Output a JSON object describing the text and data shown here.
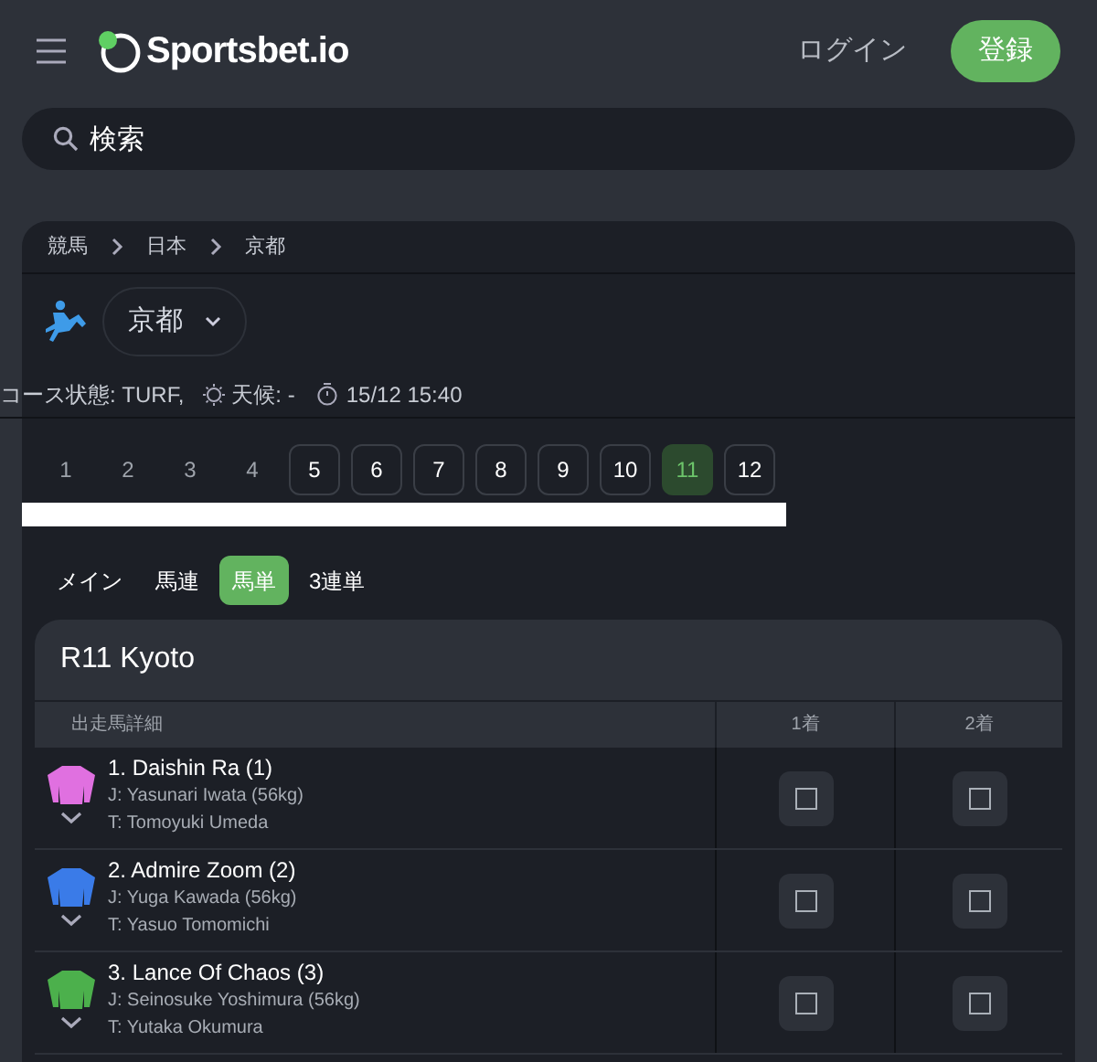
{
  "header": {
    "logo": "Sportsbet.io",
    "login": "ログイン",
    "register": "登録"
  },
  "search": {
    "placeholder": "検索"
  },
  "breadcrumb": [
    "競馬",
    "日本",
    "京都"
  ],
  "venue": {
    "label": "京都"
  },
  "info": {
    "course": "コース状態: TURF,",
    "weather": "天候: -",
    "time": "15/12 15:40"
  },
  "races": [
    {
      "label": "1",
      "available": false,
      "selected": false
    },
    {
      "label": "2",
      "available": false,
      "selected": false
    },
    {
      "label": "3",
      "available": false,
      "selected": false
    },
    {
      "label": "4",
      "available": false,
      "selected": false
    },
    {
      "label": "5",
      "available": true,
      "selected": false
    },
    {
      "label": "6",
      "available": true,
      "selected": false
    },
    {
      "label": "7",
      "available": true,
      "selected": false
    },
    {
      "label": "8",
      "available": true,
      "selected": false
    },
    {
      "label": "9",
      "available": true,
      "selected": false
    },
    {
      "label": "10",
      "available": true,
      "selected": false
    },
    {
      "label": "11",
      "available": true,
      "selected": true
    },
    {
      "label": "12",
      "available": true,
      "selected": false
    }
  ],
  "tabs": [
    {
      "label": "メイン",
      "selected": false
    },
    {
      "label": "馬連",
      "selected": false
    },
    {
      "label": "馬単",
      "selected": true
    },
    {
      "label": "3連単",
      "selected": false
    }
  ],
  "card": {
    "title": "R11 Kyoto",
    "columns": [
      "出走馬詳細",
      "1着",
      "2着"
    ],
    "runners": [
      {
        "name": "1. Daishin Ra (1)",
        "jockey": "J: Yasunari Iwata (56kg)",
        "trainer": "T: Tomoyuki Umeda",
        "color": "#e070e0",
        "first": false,
        "second": false
      },
      {
        "name": "2. Admire Zoom (2)",
        "jockey": "J: Yuga Kawada (56kg)",
        "trainer": "T: Yasuo Tomomichi",
        "color": "#3a7be8",
        "first": false,
        "second": false
      },
      {
        "name": "3. Lance Of Chaos (3)",
        "jockey": "J: Seinosuke Yoshimura (56kg)",
        "trainer": "T: Yutaka Okumura",
        "color": "#4cb04c",
        "first": false,
        "second": false
      }
    ]
  }
}
